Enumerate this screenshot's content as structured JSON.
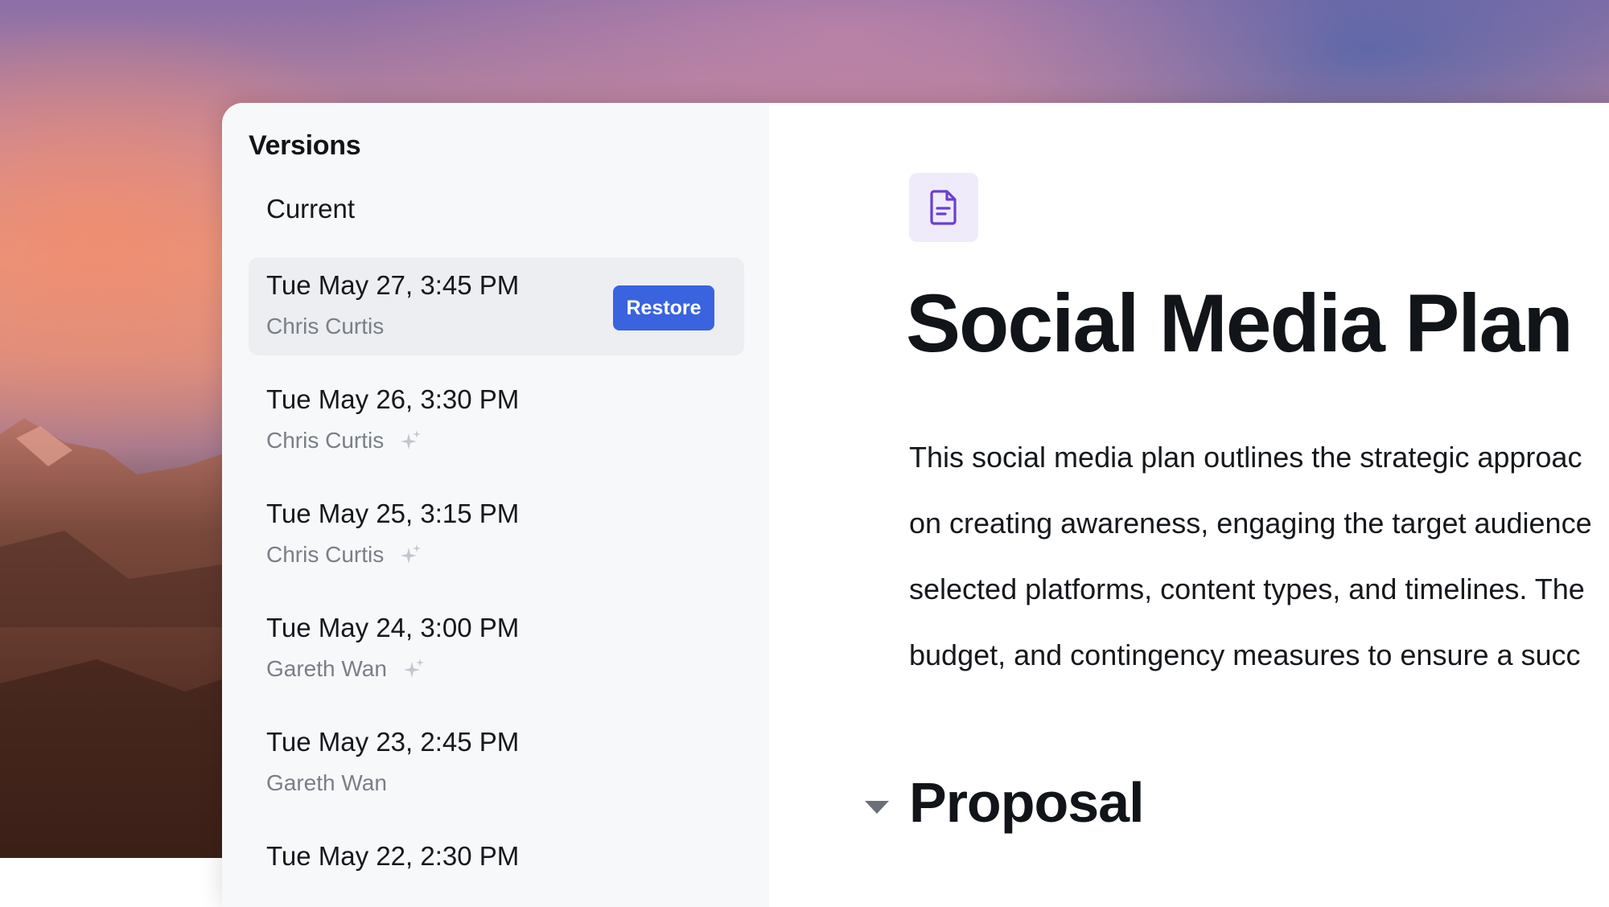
{
  "sidebar": {
    "title": "Versions",
    "current_label": "Current",
    "restore_label": "Restore",
    "versions": [
      {
        "date": "Tue May 27, 3:45 PM",
        "author": "Chris Curtis",
        "ai": false,
        "selected": true
      },
      {
        "date": "Tue May 26, 3:30 PM",
        "author": "Chris Curtis",
        "ai": true,
        "selected": false
      },
      {
        "date": "Tue May 25, 3:15 PM",
        "author": "Chris Curtis",
        "ai": true,
        "selected": false
      },
      {
        "date": "Tue May 24, 3:00 PM",
        "author": "Gareth Wan",
        "ai": true,
        "selected": false
      },
      {
        "date": "Tue May 23, 2:45 PM",
        "author": "Gareth Wan",
        "ai": false,
        "selected": false
      },
      {
        "date": "Tue May 22, 2:30 PM",
        "author": "",
        "ai": false,
        "selected": false
      }
    ]
  },
  "document": {
    "icon": "document-icon",
    "title": "Social Media Plan",
    "body_lines": [
      "This social media plan outlines the strategic approac",
      "on creating awareness, engaging the target audience",
      "selected platforms, content types, and timelines. The",
      "budget, and contingency measures to ensure a succ"
    ],
    "section_heading": "Proposal"
  },
  "colors": {
    "accent": "#3a63e0",
    "icon_bg": "#efebfb",
    "icon_fg": "#6a3fd0",
    "sidebar_bg": "#f7f8fa",
    "selected_bg": "#eceef1"
  }
}
